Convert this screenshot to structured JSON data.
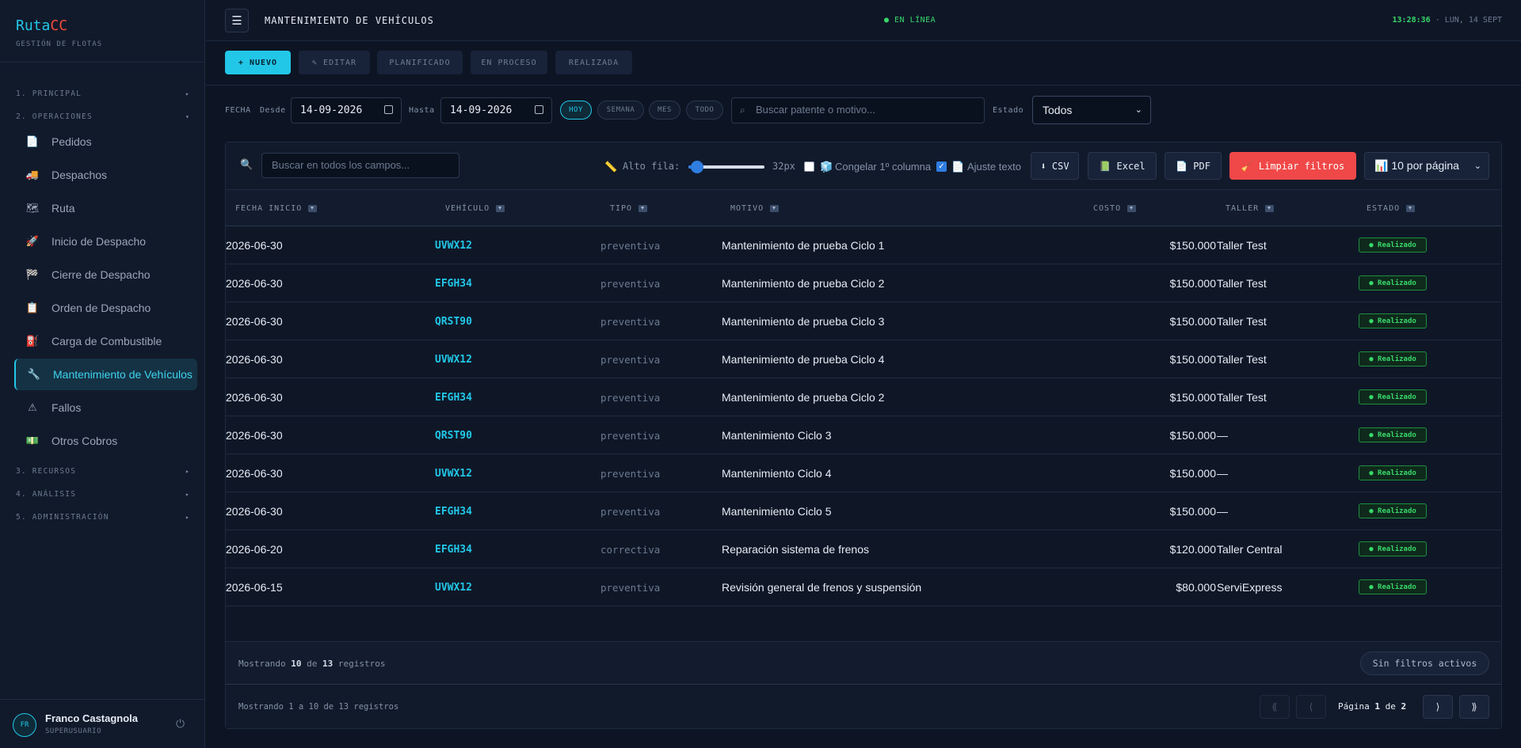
{
  "sidebar": {
    "brand_a": "Ruta",
    "brand_b": "CC",
    "brand_sub": "GESTIÓN DE FLOTAS",
    "sections": [
      "1. PRINCIPAL",
      "2. OPERACIONES",
      "3. RECURSOS",
      "4. ANÁLISIS",
      "5. ADMINISTRACIÓN"
    ],
    "section_arrows": [
      "▸",
      "▾",
      "▸",
      "▸",
      "▸"
    ],
    "items": [
      {
        "label": "Pedidos",
        "icon": "📄"
      },
      {
        "label": "Despachos",
        "icon": "🚚"
      },
      {
        "label": "Ruta",
        "icon": "🗺"
      },
      {
        "label": "Inicio de Despacho",
        "icon": "🚀"
      },
      {
        "label": "Cierre de Despacho",
        "icon": "🏁"
      },
      {
        "label": "Orden de Despacho",
        "icon": "📋"
      },
      {
        "label": "Carga de Combustible",
        "icon": "⛽"
      },
      {
        "label": "Mantenimiento de Vehículos",
        "icon": "🔧"
      },
      {
        "label": "Fallos",
        "icon": "⚠"
      },
      {
        "label": "Otros Cobros",
        "icon": "💵"
      }
    ],
    "active_item": "Mantenimiento de Vehículos",
    "user": {
      "initials": "FR",
      "name": "Franco Castagnola",
      "role": "SUPERUSUARIO",
      "power_icon": "⏻"
    }
  },
  "topbar": {
    "menu_icon": "☰",
    "title": "MANTENIMIENTO DE VEHÍCULOS",
    "status": "● EN LÍNEA",
    "time": "13:28:36",
    "date": " · LUN, 14 SEPT"
  },
  "actions": {
    "new": "+ NUEVO",
    "edit": "✎ EDITAR",
    "planned": "PLANIFICADO",
    "in_process": "EN PROCESO",
    "done": "REALIZADA"
  },
  "filters": {
    "fecha_label": "FECHA",
    "desde_label": "Desde",
    "desde_value": "14-09-2026",
    "hasta_label": "Hasta",
    "hasta_value": "14-09-2026",
    "quick": [
      "HOY",
      "SEMANA",
      "MES",
      "TODO"
    ],
    "quick_active": "HOY",
    "search_icon": "⌕",
    "search_placeholder": "Buscar patente o motivo...",
    "estado_label": "Estado",
    "estado_value": "Todos",
    "chevron": "⌄"
  },
  "toolbar": {
    "search_icon": "🔍",
    "search_placeholder": "Buscar en todos los campos...",
    "row_height_icon": "📏",
    "row_height_label": "Alto fila:",
    "row_height_value": "32px",
    "freeze_icon": "🧊",
    "freeze_label": "Congelar 1º columna",
    "freeze_checked": false,
    "wrap_icon": "📄",
    "wrap_label": "Ajuste texto",
    "wrap_checked": true,
    "check_mark": "✓",
    "csv": "⬇ CSV",
    "excel": "📗 Excel",
    "pdf": "📄 PDF",
    "clear": "🧹 Limpiar filtros",
    "per_page": "📊 10 por página",
    "chevron": "⌄"
  },
  "table": {
    "headers": [
      "FECHA INICIO",
      "VEHÍCULO",
      "TIPO",
      "MOTIVO",
      "COSTO",
      "TALLER",
      "ESTADO"
    ],
    "rows": [
      {
        "fecha": "2026-06-30",
        "vehiculo": "UVWX12",
        "tipo": "preventiva",
        "motivo": "Mantenimiento de prueba Ciclo 1",
        "costo": "$150.000",
        "taller": "Taller Test",
        "estado": "● Realizado"
      },
      {
        "fecha": "2026-06-30",
        "vehiculo": "EFGH34",
        "tipo": "preventiva",
        "motivo": "Mantenimiento de prueba Ciclo 2",
        "costo": "$150.000",
        "taller": "Taller Test",
        "estado": "● Realizado"
      },
      {
        "fecha": "2026-06-30",
        "vehiculo": "QRST90",
        "tipo": "preventiva",
        "motivo": "Mantenimiento de prueba Ciclo 3",
        "costo": "$150.000",
        "taller": "Taller Test",
        "estado": "● Realizado"
      },
      {
        "fecha": "2026-06-30",
        "vehiculo": "UVWX12",
        "tipo": "preventiva",
        "motivo": "Mantenimiento de prueba Ciclo 4",
        "costo": "$150.000",
        "taller": "Taller Test",
        "estado": "● Realizado"
      },
      {
        "fecha": "2026-06-30",
        "vehiculo": "EFGH34",
        "tipo": "preventiva",
        "motivo": "Mantenimiento de prueba Ciclo 2",
        "costo": "$150.000",
        "taller": "Taller Test",
        "estado": "● Realizado"
      },
      {
        "fecha": "2026-06-30",
        "vehiculo": "QRST90",
        "tipo": "preventiva",
        "motivo": "Mantenimiento Ciclo 3",
        "costo": "$150.000",
        "taller": "—",
        "estado": "● Realizado"
      },
      {
        "fecha": "2026-06-30",
        "vehiculo": "UVWX12",
        "tipo": "preventiva",
        "motivo": "Mantenimiento Ciclo 4",
        "costo": "$150.000",
        "taller": "—",
        "estado": "● Realizado"
      },
      {
        "fecha": "2026-06-30",
        "vehiculo": "EFGH34",
        "tipo": "preventiva",
        "motivo": "Mantenimiento Ciclo 5",
        "costo": "$150.000",
        "taller": "—",
        "estado": "● Realizado"
      },
      {
        "fecha": "2026-06-20",
        "vehiculo": "EFGH34",
        "tipo": "correctiva",
        "motivo": "Reparación sistema de frenos",
        "costo": "$120.000",
        "taller": "Taller Central",
        "estado": "● Realizado"
      },
      {
        "fecha": "2026-06-15",
        "vehiculo": "UVWX12",
        "tipo": "preventiva",
        "motivo": "Revisión general de frenos y suspensión",
        "costo": "$80.000",
        "taller": "ServiExpress",
        "estado": "● Realizado"
      }
    ]
  },
  "footer": {
    "showing_a": "Mostrando ",
    "showing_count": "10",
    "showing_mid": " de ",
    "showing_total": "13",
    "showing_b": " registros",
    "no_filters": "Sin filtros activos",
    "range": "Mostrando 1 a 10 de 13 registros",
    "first": "⟪",
    "prev": "⟨",
    "page_a": "Página ",
    "page_current": "1",
    "page_mid": " de ",
    "page_total": "2",
    "next": "⟩",
    "last": "⟫"
  },
  "colors": {
    "accent": "#22c7e8",
    "success": "#38d86a",
    "danger": "#f04848",
    "brand_red": "#f04b3c"
  }
}
